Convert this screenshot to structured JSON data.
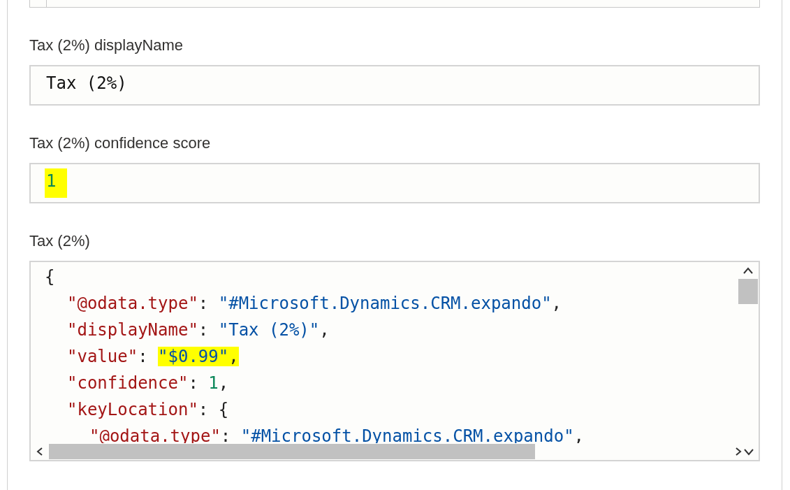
{
  "fields": [
    {
      "label": "Tax (2%) displayName",
      "value": "Tax (2%)",
      "highlighted": false
    },
    {
      "label": "Tax (2%) confidence score",
      "value": "1",
      "highlighted": true
    }
  ],
  "editor": {
    "label": "Tax (2%)",
    "lines": [
      {
        "tokens": [
          {
            "kind": "punct",
            "text": "{"
          }
        ],
        "children": [
          {
            "tokens": [
              {
                "kind": "key",
                "text": "\"@odata.type\""
              },
              {
                "kind": "punct",
                "text": ": "
              },
              {
                "kind": "string",
                "text": "\"#Microsoft.Dynamics.CRM.expando\""
              },
              {
                "kind": "punct",
                "text": ","
              }
            ]
          },
          {
            "tokens": [
              {
                "kind": "key",
                "text": "\"displayName\""
              },
              {
                "kind": "punct",
                "text": ": "
              },
              {
                "kind": "string",
                "text": "\"Tax (2%)\""
              },
              {
                "kind": "punct",
                "text": ","
              }
            ]
          },
          {
            "tokens": [
              {
                "kind": "key",
                "text": "\"value\""
              },
              {
                "kind": "punct",
                "text": ": "
              },
              {
                "kind": "string",
                "text": "\"$0.99\"",
                "highlighted": true
              },
              {
                "kind": "punct",
                "text": ",",
                "highlighted": true
              }
            ]
          },
          {
            "tokens": [
              {
                "kind": "key",
                "text": "\"confidence\""
              },
              {
                "kind": "punct",
                "text": ": "
              },
              {
                "kind": "number",
                "text": "1"
              },
              {
                "kind": "punct",
                "text": ","
              }
            ]
          },
          {
            "tokens": [
              {
                "kind": "key",
                "text": "\"keyLocation\""
              },
              {
                "kind": "punct",
                "text": ": {"
              }
            ],
            "children": [
              {
                "tokens": [
                  {
                    "kind": "key",
                    "text": "\"@odata.type\""
                  },
                  {
                    "kind": "punct",
                    "text": ": "
                  },
                  {
                    "kind": "string",
                    "text": "\"#Microsoft.Dynamics.CRM.expando\""
                  },
                  {
                    "kind": "punct",
                    "text": ","
                  }
                ]
              }
            ]
          }
        ]
      }
    ]
  }
}
